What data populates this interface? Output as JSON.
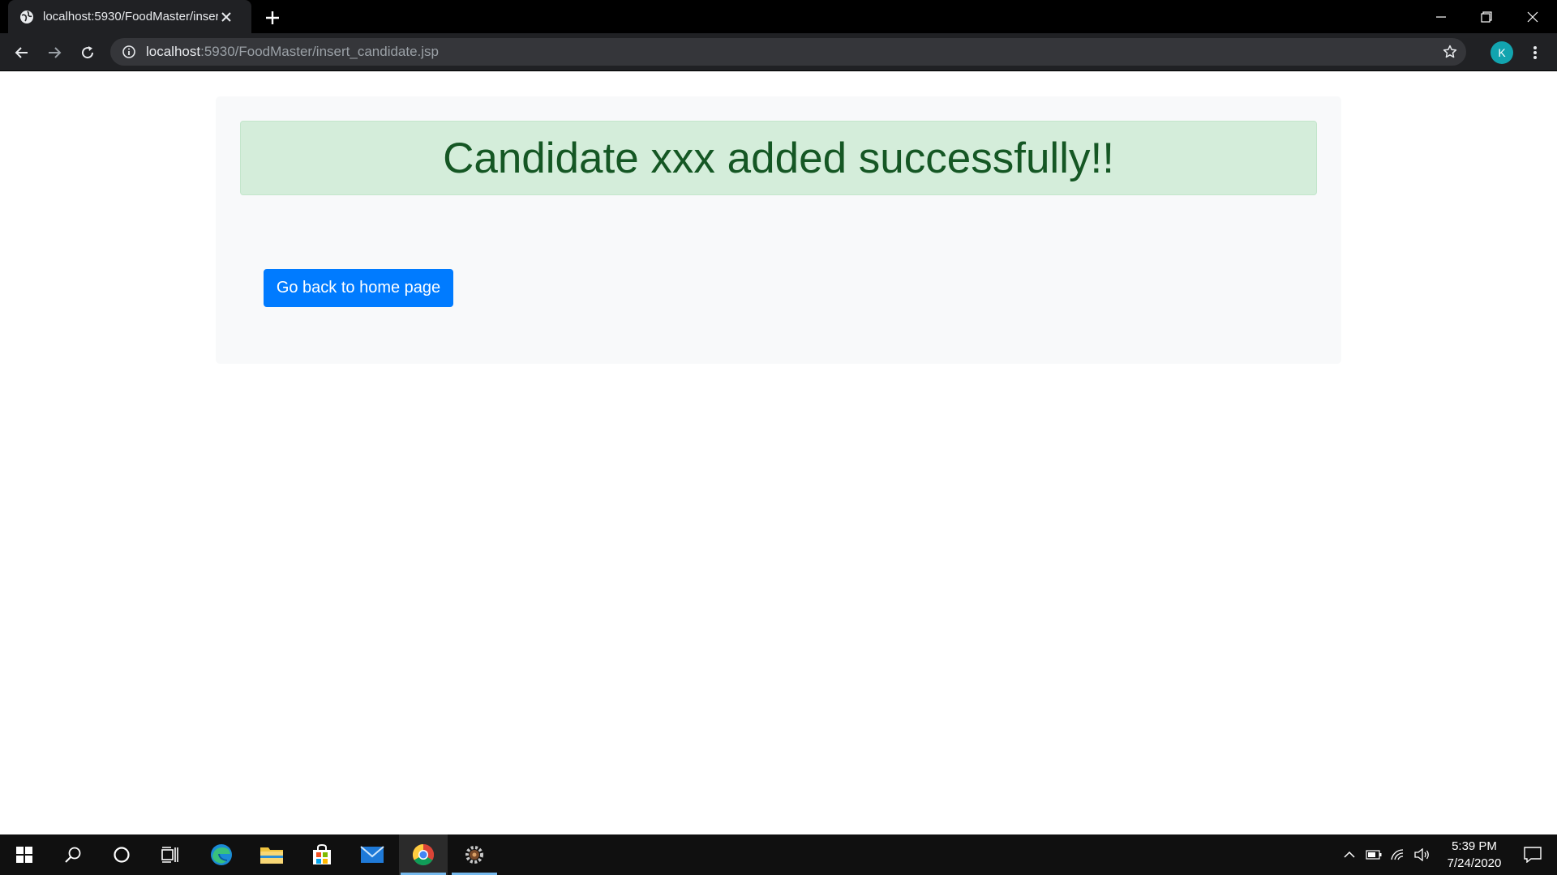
{
  "browser": {
    "tab_title": "localhost:5930/FoodMaster/insert_candidate.jsp",
    "url_host": "localhost",
    "url_rest": ":5930/FoodMaster/insert_candidate.jsp",
    "profile_initial": "K",
    "profile_color": "#12a4af"
  },
  "page": {
    "alert_message": "Candidate xxx added successfully!!",
    "home_button_label": "Go back to home page",
    "colors": {
      "alert_bg": "#d4edda",
      "alert_text": "#155724",
      "button_bg": "#007bff",
      "jumbotron_bg": "#f8f9fa"
    }
  },
  "taskbar": {
    "apps": [
      "start-icon",
      "search-icon",
      "cortana-icon",
      "task-view-icon",
      "edge-icon",
      "file-explorer-icon",
      "store-icon",
      "mail-icon",
      "chrome-icon",
      "settings-gear-icon"
    ],
    "active_app": "chrome-icon",
    "time": "5:39 PM",
    "date": "7/24/2020"
  }
}
